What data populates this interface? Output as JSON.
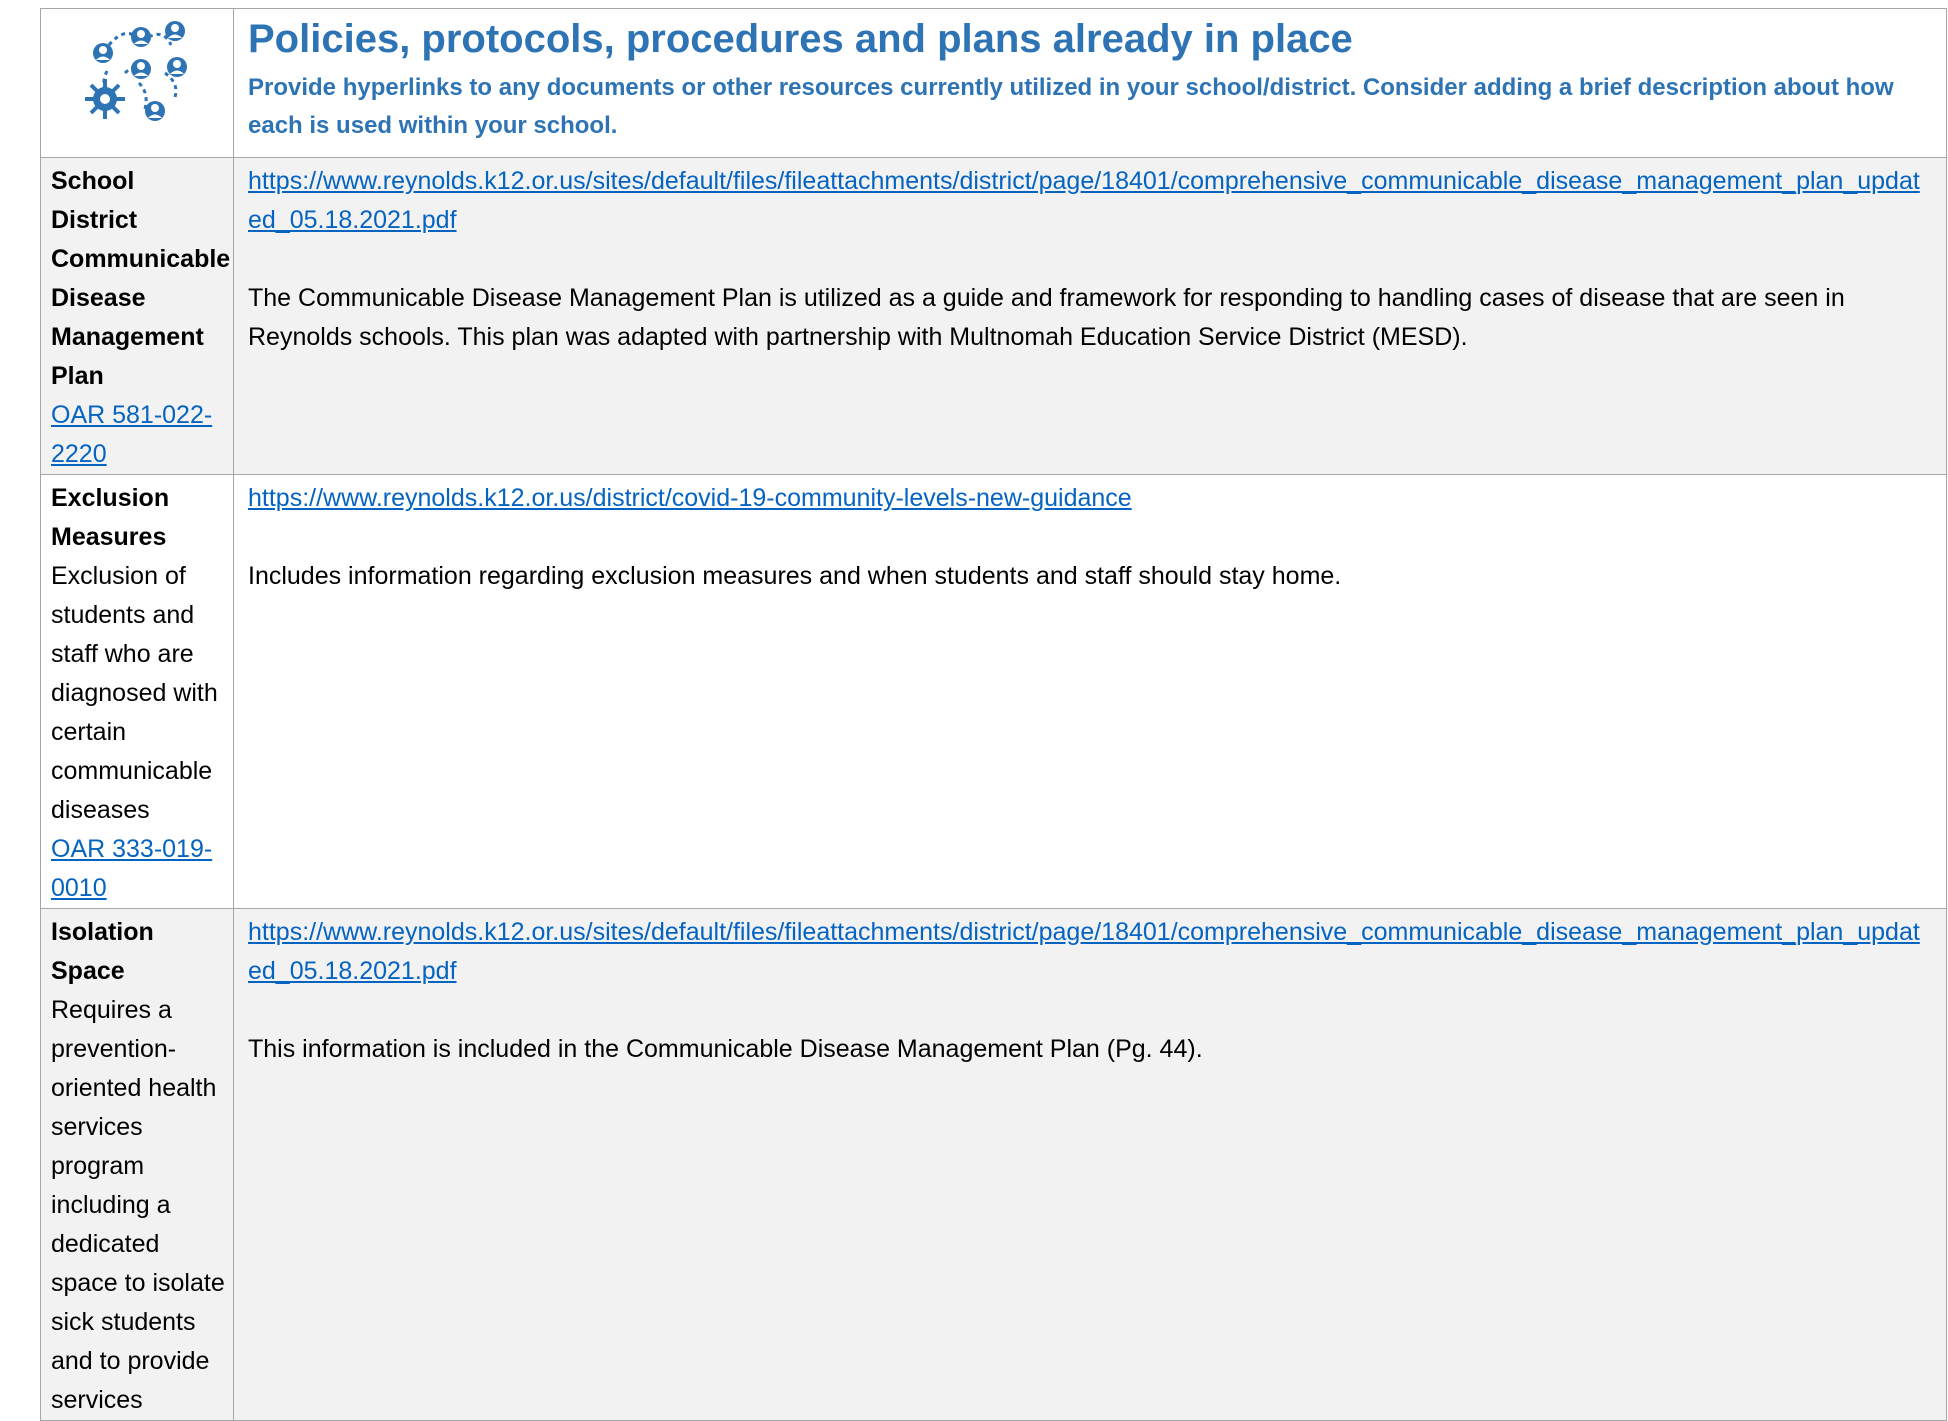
{
  "header": {
    "icon": "people-network-icon",
    "title": "Policies, protocols, procedures and plans already in place",
    "subtitle": "Provide hyperlinks to any documents or other resources currently utilized in your school/district. Consider adding a brief description about how each is used within your school."
  },
  "colors": {
    "heading": "#2e74b5",
    "link": "#0563c1",
    "shaded_row": "#f2f2f2",
    "border": "#a6a6a6"
  },
  "rows": [
    {
      "label_bold": "School District Communicable Disease Management Plan",
      "label_desc": "",
      "label_link": "OAR 581-022-2220",
      "content_link": "https://www.reynolds.k12.or.us/sites/default/files/fileattachments/district/page/18401/comprehensive_communicable_disease_management_plan_updated_05.18.2021.pdf",
      "content_text": "The Communicable Disease Management Plan is utilized as a guide and framework for responding to handling cases of disease that are seen in Reynolds schools. This plan was adapted with partnership with Multnomah Education Service District (MESD)."
    },
    {
      "label_bold": "Exclusion Measures",
      "label_desc": "Exclusion of students and staff who are diagnosed with certain communicable diseases",
      "label_link": "OAR 333-019-0010",
      "content_link": "https://www.reynolds.k12.or.us/district/covid-19-community-levels-new-guidance",
      "content_text": "Includes information regarding exclusion measures and when students and staff should stay home."
    },
    {
      "label_bold": "Isolation Space",
      "label_desc": "Requires a prevention-oriented health services program including a dedicated space to isolate sick students and to provide services",
      "label_link": "",
      "content_link": "https://www.reynolds.k12.or.us/sites/default/files/fileattachments/district/page/18401/comprehensive_communicable_disease_management_plan_updated_05.18.2021.pdf",
      "content_text": "This information is included in the Communicable Disease Management Plan (Pg. 44)."
    }
  ]
}
